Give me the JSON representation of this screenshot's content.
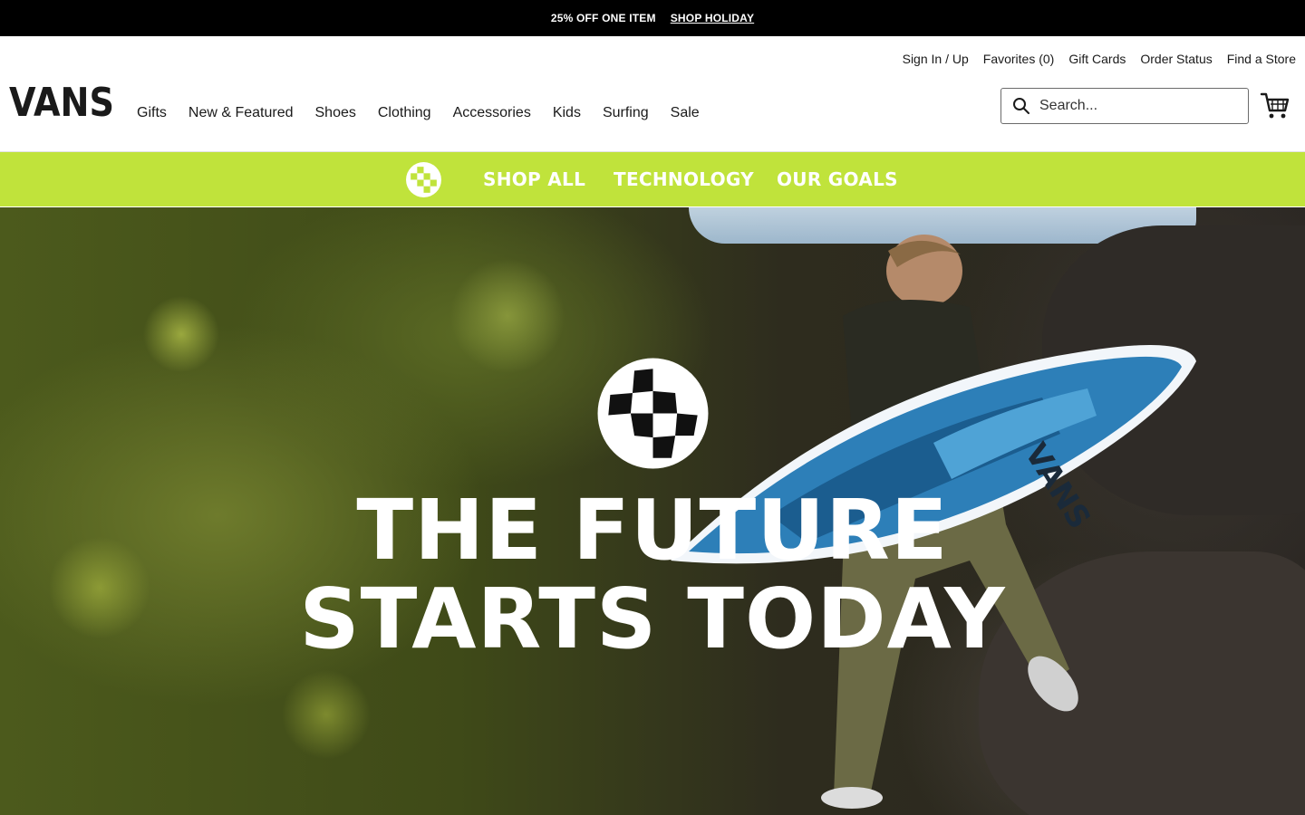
{
  "promo": {
    "text": "25% OFF ONE ITEM",
    "link": "SHOP HOLIDAY"
  },
  "utility_nav": [
    {
      "label": "Sign In / Up"
    },
    {
      "label": "Favorites (0)"
    },
    {
      "label": "Gift Cards"
    },
    {
      "label": "Order Status"
    },
    {
      "label": "Find a Store"
    }
  ],
  "brand": {
    "logo_text": "VANS"
  },
  "main_nav": [
    {
      "label": "Gifts"
    },
    {
      "label": "New & Featured"
    },
    {
      "label": "Shoes"
    },
    {
      "label": "Clothing"
    },
    {
      "label": "Accessories"
    },
    {
      "label": "Kids"
    },
    {
      "label": "Surfing"
    },
    {
      "label": "Sale"
    }
  ],
  "search": {
    "placeholder": "Search..."
  },
  "subnav": {
    "icon": "checkerboard-globe-icon",
    "links": [
      {
        "label": "SHOP ALL"
      },
      {
        "label": "TECHNOLOGY"
      },
      {
        "label": "OUR GOALS"
      }
    ],
    "background": "#c0e33b"
  },
  "hero": {
    "line1": "THE FUTURE",
    "line2": "STARTS TODAY",
    "emblem_icon": "checkerboard-globe-icon"
  }
}
